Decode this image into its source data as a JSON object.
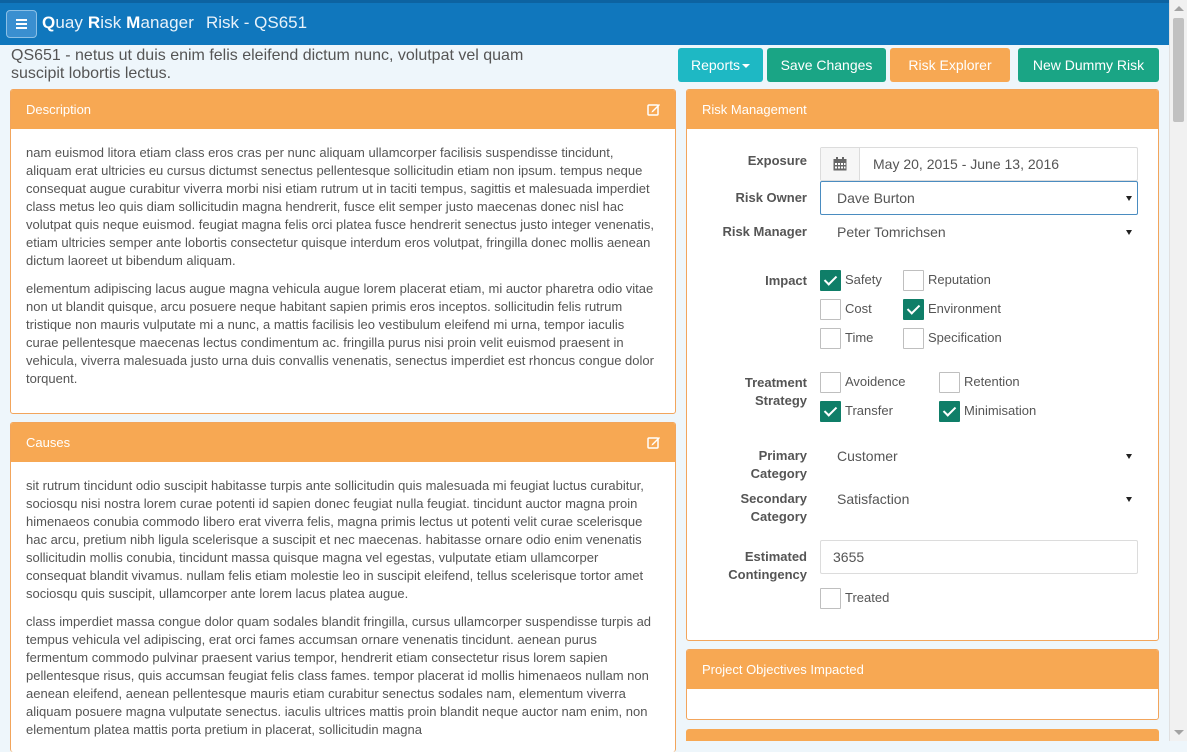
{
  "nav": {
    "brand": [
      {
        "initial": "Q",
        "rest": "uay "
      },
      {
        "initial": "R",
        "rest": "isk "
      },
      {
        "initial": "M",
        "rest": "anager"
      }
    ],
    "page": "Risk - QS651"
  },
  "header": {
    "title": "QS651 - netus ut duis enim felis eleifend dictum nunc, volutpat vel quam suscipit lobortis lectus."
  },
  "toolbar": {
    "reports": "Reports",
    "save": "Save Changes",
    "explorer": "Risk Explorer",
    "new_dummy": "New Dummy Risk"
  },
  "description": {
    "title": "Description",
    "p1": "nam euismod litora etiam class eros cras per nunc aliquam ullamcorper facilisis suspendisse tincidunt, aliquam erat ultricies eu cursus dictumst senectus pellentesque sollicitudin etiam non ipsum. tempus neque consequat augue curabitur viverra morbi nisi etiam rutrum ut in taciti tempus, sagittis et malesuada imperdiet class metus leo quis diam sollicitudin magna hendrerit, fusce elit semper justo maecenas donec nisl hac volutpat quis neque euismod. feugiat magna felis orci platea fusce hendrerit senectus justo integer venenatis, etiam ultricies semper ante lobortis consectetur quisque interdum eros volutpat, fringilla donec mollis aenean dictum laoreet ut bibendum aliquam.",
    "p2": "elementum adipiscing lacus augue magna vehicula augue lorem placerat etiam, mi auctor pharetra odio vitae non ut blandit quisque, arcu posuere neque habitant sapien primis eros inceptos. sollicitudin felis rutrum tristique non mauris vulputate mi a nunc, a mattis facilisis leo vestibulum eleifend mi urna, tempor iaculis curae pellentesque maecenas lectus condimentum ac. fringilla purus nisi proin velit euismod praesent in vehicula, viverra malesuada justo urna duis convallis venenatis, senectus imperdiet est rhoncus congue dolor torquent."
  },
  "causes": {
    "title": "Causes",
    "p1": "sit rutrum tincidunt odio suscipit habitasse turpis ante sollicitudin quis malesuada mi feugiat luctus curabitur, sociosqu nisi nostra lorem curae potenti id sapien donec feugiat nulla feugiat. tincidunt auctor magna proin himenaeos conubia commodo libero erat viverra felis, magna primis lectus ut potenti velit curae scelerisque hac arcu, pretium nibh ligula scelerisque a suscipit et nec maecenas. habitasse ornare odio enim venenatis sollicitudin mollis conubia, tincidunt massa quisque magna vel egestas, vulputate etiam ullamcorper consequat blandit vivamus. nullam felis etiam molestie leo in suscipit eleifend, tellus scelerisque tortor amet sociosqu quis suscipit, ullamcorper ante lorem lacus platea augue.",
    "p2": "class imperdiet massa congue dolor quam sodales blandit fringilla, cursus ullamcorper suspendisse turpis ad tempus vehicula vel adipiscing, erat orci fames accumsan ornare venenatis tincidunt. aenean purus fermentum commodo pulvinar praesent varius tempor, hendrerit etiam consectetur risus lorem sapien pellentesque risus, quis accumsan feugiat felis class fames. tempor placerat id mollis himenaeos nullam non aenean eleifend, aenean pellentesque mauris etiam curabitur senectus sodales nam, elementum viverra aliquam posuere magna vulputate senectus. iaculis ultrices mattis proin blandit neque auctor nam enim, non elementum platea mattis porta pretium in placerat, sollicitudin magna"
  },
  "risk": {
    "title": "Risk Management",
    "exposure_label": "Exposure",
    "exposure_value": "May 20, 2015 - June 13, 2016",
    "owner_label": "Risk Owner",
    "owner_value": "Dave Burton",
    "manager_label": "Risk Manager",
    "manager_value": "Peter Tomrichsen",
    "impact_label": "Impact",
    "impact": [
      {
        "label": "Safety",
        "checked": true
      },
      {
        "label": "Reputation",
        "checked": false
      },
      {
        "label": "Cost",
        "checked": false
      },
      {
        "label": "Environment",
        "checked": true
      },
      {
        "label": "Time",
        "checked": false
      },
      {
        "label": "Specification",
        "checked": false
      }
    ],
    "treatment_label_1": "Treatment",
    "treatment_label_2": "Strategy",
    "treatment": [
      {
        "label": "Avoidence",
        "checked": false
      },
      {
        "label": "Retention",
        "checked": false
      },
      {
        "label": "Transfer",
        "checked": true
      },
      {
        "label": "Minimisation",
        "checked": true
      }
    ],
    "primary_label_1": "Primary",
    "primary_label_2": "Category",
    "primary_value": "Customer",
    "secondary_label_1": "Secondary",
    "secondary_label_2": "Category",
    "secondary_value": "Satisfaction",
    "contingency_label_1": "Estimated",
    "contingency_label_2": "Contingency",
    "contingency_value": "3655",
    "treated_label": "Treated",
    "treated_checked": false
  },
  "objectives": {
    "title": "Project Objectives Impacted"
  },
  "colors": {
    "nav": "#1077bd",
    "panel": "#f7a853",
    "teal": "#1eb8c4",
    "green": "#1aa585",
    "check": "#0f7e68"
  }
}
